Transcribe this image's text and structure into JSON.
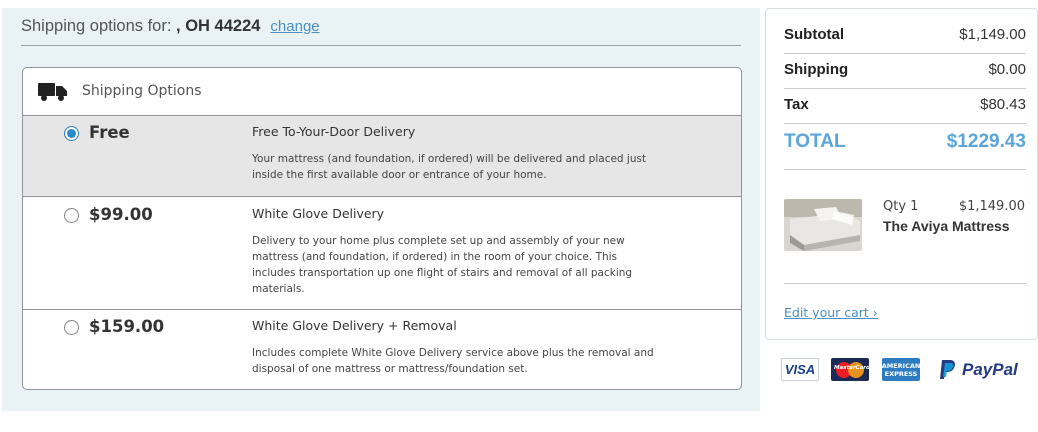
{
  "shipping": {
    "header_prefix": "Shipping options for: ",
    "zip": ", OH 44224",
    "change_label": "change",
    "options_title": "Shipping Options",
    "options": [
      {
        "price": "Free",
        "name": "Free To-Your-Door Delivery",
        "desc": "Your mattress (and foundation, if ordered) will be delivered and placed just inside the first available door or entrance of your home.",
        "selected": true
      },
      {
        "price": "$99.00",
        "name": "White Glove Delivery",
        "desc": "Delivery to your home plus complete set up and assembly of your new mattress (and foundation, if ordered) in the room of your choice. This includes transportation up one flight of stairs and removal of all packing materials.",
        "selected": false
      },
      {
        "price": "$159.00",
        "name": "White Glove Delivery + Removal",
        "desc": "Includes complete White Glove Delivery service above plus the removal and disposal of one mattress or mattress/foundation set.",
        "selected": false
      }
    ]
  },
  "summary": {
    "subtotal_label": "Subtotal",
    "subtotal": "$1,149.00",
    "shipping_label": "Shipping",
    "shipping": "$0.00",
    "tax_label": "Tax",
    "tax": "$80.43",
    "total_label": "TOTAL",
    "total": "$1229.43",
    "item": {
      "qty": "Qty 1",
      "price": "$1,149.00",
      "name": "The Aviya Mattress"
    },
    "edit_cart": "Edit your cart ›"
  },
  "payment": {
    "visa": "VISA",
    "mastercard": "MasterCard",
    "amex_top": "AMERICAN",
    "amex_bottom": "EXPRESS",
    "paypal": "PayPal"
  },
  "colors": {
    "accent": "#5aa6da",
    "panel_bg": "#e9f3f6",
    "selected_row": "#e6e6e6",
    "link": "#4a8fc4"
  }
}
